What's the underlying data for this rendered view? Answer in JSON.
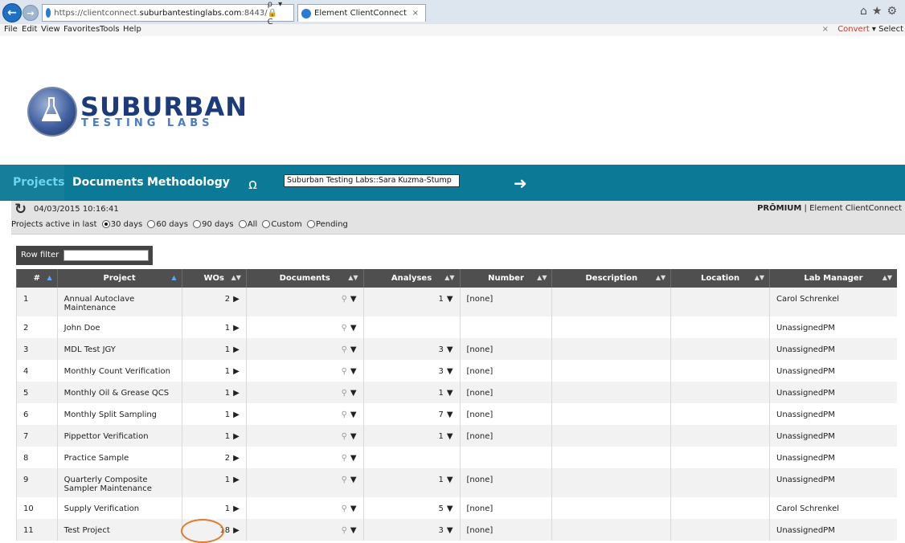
{
  "browser": {
    "url_prefix": "https://clientconnect.",
    "url_domain": "suburbantestinglabs.com",
    "url_suffix": ":8443/",
    "addr_controls": "ρ ▾ 🔒 C",
    "tab_title": "Element ClientConnect",
    "tab_close": "×",
    "menu": [
      "File",
      "Edit",
      "View",
      "Favorites",
      "Tools",
      "Help"
    ],
    "menu_right_close": "×",
    "menu_right_convert": "Convert",
    "menu_right_select": "Select",
    "top_icons": "⌂★⚙"
  },
  "logo": {
    "line1": "SUBURBAN",
    "line2": "TESTING LABS"
  },
  "appnav": {
    "items": [
      "Projects",
      "Documents",
      "Methodology"
    ],
    "active": "Projects",
    "user": "Suburban Testing Labs::Sara Kuzma-Stump"
  },
  "info": {
    "timestamp": "04/03/2015 10:16:41",
    "brand_mark": "PRŌMIUM",
    "brand_sep": " | ",
    "brand_app": "Element ClientConnect",
    "filter_label": "Projects active in last",
    "filter_options": [
      "30 days",
      "60 days",
      "90 days",
      "All",
      "Custom",
      "Pending"
    ],
    "filter_selected": "30 days"
  },
  "row_filter_label": "Row filter",
  "table": {
    "headers": [
      "#",
      "Project",
      "WOs",
      "Documents",
      "Analyses",
      "Number",
      "Description",
      "Location",
      "Lab Manager"
    ],
    "rows": [
      {
        "n": "1",
        "project": "Annual Autoclave Maintenance",
        "wos": "2",
        "analyses": "1",
        "number": "[none]",
        "manager": "Carol Schrenkel"
      },
      {
        "n": "2",
        "project": "John Doe",
        "wos": "1",
        "analyses": "",
        "number": "",
        "manager": "UnassignedPM"
      },
      {
        "n": "3",
        "project": "MDL Test JGY",
        "wos": "1",
        "analyses": "3",
        "number": "[none]",
        "manager": "UnassignedPM"
      },
      {
        "n": "4",
        "project": "Monthly Count Verification",
        "wos": "1",
        "analyses": "3",
        "number": "[none]",
        "manager": "UnassignedPM"
      },
      {
        "n": "5",
        "project": "Monthly Oil & Grease QCS",
        "wos": "1",
        "analyses": "1",
        "number": "[none]",
        "manager": "UnassignedPM"
      },
      {
        "n": "6",
        "project": "Monthly Split Sampling",
        "wos": "1",
        "analyses": "7",
        "number": "[none]",
        "manager": "UnassignedPM"
      },
      {
        "n": "7",
        "project": "Pippettor Verification",
        "wos": "1",
        "analyses": "1",
        "number": "[none]",
        "manager": "UnassignedPM"
      },
      {
        "n": "8",
        "project": "Practice Sample",
        "wos": "2",
        "analyses": "",
        "number": "",
        "manager": "UnassignedPM"
      },
      {
        "n": "9",
        "project": "Quarterly Composite Sampler Maintenance",
        "wos": "1",
        "analyses": "1",
        "number": "[none]",
        "manager": "UnassignedPM"
      },
      {
        "n": "10",
        "project": "Supply Verification",
        "wos": "1",
        "analyses": "5",
        "number": "[none]",
        "manager": "Carol Schrenkel"
      },
      {
        "n": "11",
        "project": "Test Project",
        "wos": "18",
        "analyses": "3",
        "number": "[none]",
        "manager": "UnassignedPM"
      }
    ]
  },
  "glyphs": {
    "wos_arrow": "▶",
    "dropdown": "▼",
    "magnifier": "🔍",
    "sort_both": "▲▼",
    "sort_asc": "▲"
  },
  "colors": {
    "nav_bg": "#0c7a96",
    "active_nav": "#6fd4ee",
    "highlight_circle": "#e07b2f",
    "header_bg": "#4f4f4f"
  }
}
